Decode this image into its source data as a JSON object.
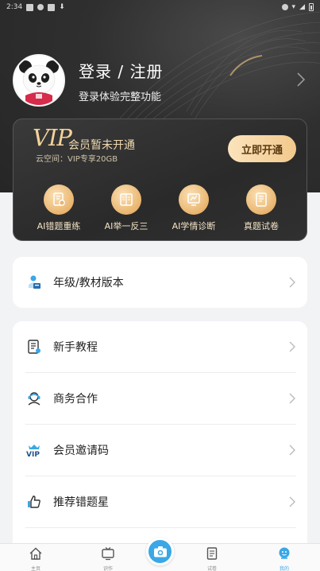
{
  "status_bar": {
    "time": "2:34"
  },
  "profile": {
    "title": "登录 / 注册",
    "subtitle": "登录体验完整功能"
  },
  "vip": {
    "logo": "VIP",
    "status": "会员暂未开通",
    "cloud": "云空间：VIP专享20GB",
    "open_button": "立即开通",
    "features": [
      {
        "label": "AI错题重练",
        "icon": "retry-doc-icon"
      },
      {
        "label": "AI举一反三",
        "icon": "book-icon"
      },
      {
        "label": "AI学情诊断",
        "icon": "diagnosis-icon"
      },
      {
        "label": "真题试卷",
        "icon": "exam-paper-icon"
      }
    ]
  },
  "menu": {
    "grade_version": "年级/教材版本",
    "items": [
      {
        "label": "新手教程",
        "icon": "tutorial-icon"
      },
      {
        "label": "商务合作",
        "icon": "cooperation-icon"
      },
      {
        "label": "会员邀请码",
        "icon": "vip-badge-icon"
      },
      {
        "label": "推荐错题星",
        "icon": "thumbs-up-icon"
      }
    ]
  },
  "bottom_nav": {
    "items": [
      {
        "label": "主页",
        "icon": "home-icon"
      },
      {
        "label": "识作",
        "icon": "tv-icon"
      },
      {
        "label": "试卷",
        "icon": "paper-icon"
      },
      {
        "label": "我的",
        "icon": "profile-icon"
      }
    ],
    "active": "我的"
  },
  "colors": {
    "accent": "#3aa7e6",
    "vip_gold": "#f3d29a",
    "header_dark": "#2f2f2f"
  }
}
